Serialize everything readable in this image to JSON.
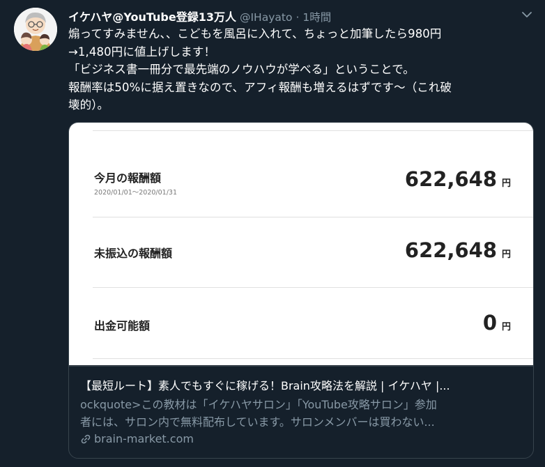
{
  "tweet": {
    "display_name": "イケハヤ@YouTube登録13万人",
    "handle": "@IHayato",
    "separator": "·",
    "time": "1時間",
    "text_lines": [
      "煽ってすみません、、こどもを風呂に入れて、ちょっと加筆したら980円",
      "→1,480円に値上げします！",
      "「ビジネス書一冊分で最先端のノウハウが学べる」ということで。",
      "報酬率は50%に据え置きなので、アフィ報酬も増えるはずです〜（これ破",
      "壊的）。"
    ]
  },
  "card": {
    "rows": [
      {
        "label": "今月の報酬額",
        "sub": "2020/01/01〜2020/01/31",
        "amount": "622,648",
        "unit": "円"
      },
      {
        "label": "未振込の報酬額",
        "amount": "622,648",
        "unit": "円"
      },
      {
        "label": "出金可能額",
        "amount": "0",
        "unit": "円"
      }
    ],
    "title": "【最短ルート】素人でもすぐに稼げる！Brain攻略法を解説 | イケハヤ |...",
    "desc_lines": [
      "ockquote>この教材は「イケハヤサロン」「YouTube攻略サロン」参加",
      "者には、サロン内で無料配布しています。サロンメンバーは買わない..."
    ],
    "domain": "brain-market.com"
  },
  "icons": {
    "avatar": "avatar-illustration",
    "caret": "chevron-down-icon",
    "link": "link-icon"
  },
  "colors": {
    "background": "#15202b",
    "secondary_text": "#8899a6",
    "border": "#38444d"
  }
}
